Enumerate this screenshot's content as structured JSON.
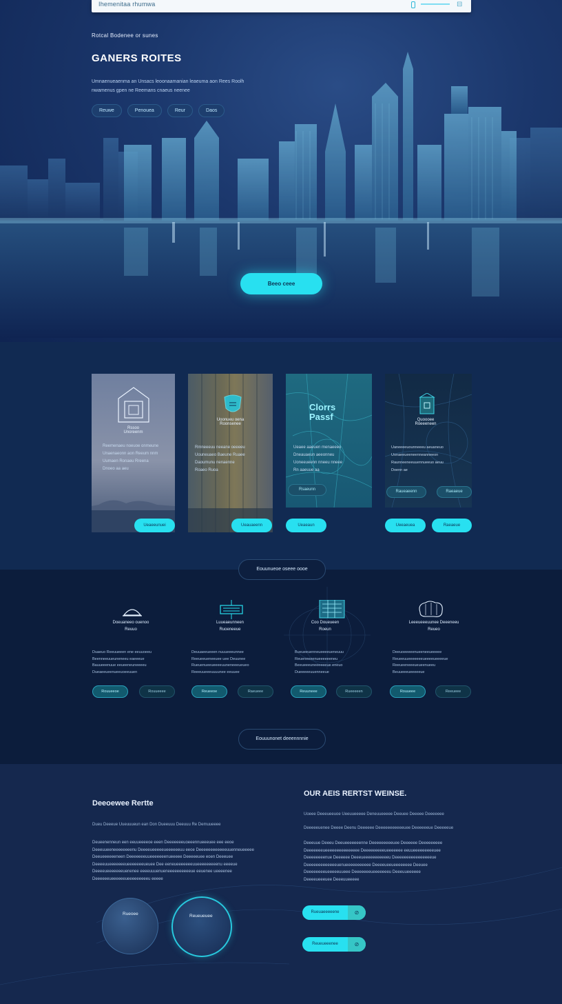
{
  "topbar": {
    "brand": "Ihemenitaa rhumwa",
    "menu_icon": "grid-icon"
  },
  "hero": {
    "eyebrow": "Rotcal Bodenee or sunes",
    "title": "GANERS ROITES",
    "subtitle": "Umnaenueaenma an Unsacs leoonaamanian leaeuma aon Rees Roolh nwamenus gpen ne Reemans cnaeus neenee",
    "chips": [
      "Reuwe",
      "Penouea",
      "Reur",
      "Daos"
    ],
    "cta": "Beeo ceee"
  },
  "cards": [
    {
      "title": "Rssoo\nUnoreenm",
      "text": "Reemenaeu noeuoe onmeune\nUnaenaeonn aon Reeum nnm\nUumaen Ronaeu Rreena\nDnoeo aa aeu",
      "button": "Ueaeeunuei",
      "icon": "house-icon"
    },
    {
      "title": "Uoonueu oena\nRoonsenee",
      "text": "Rmneeeuu neeane oeeeeu\nUouneuaeo Baeune Ruaee\nDaoumunu nenaenne\nRoaeo Ruoa",
      "button": "Ueauaeenn",
      "icon": "shield-icon"
    },
    {
      "title": "Clorrs\nPassf",
      "text": "Ueaee aaeuen menaeeeo\nDneauaeun aeeonneu\nUoneeueenn nneeu nneee\nRn aaeuue aa",
      "button": "Ueaeaun",
      "secondary": "Rsaeunn",
      "icon": "map-icon"
    },
    {
      "title": "Quoooee\nRoeeeneen",
      "text": "Uaneeeeuounneeeu aeuaneuo\nUonaeeueeneenneanneeon\nRaunneeneeuuennueeuo aeuu\nDoenn ae",
      "button": "Ueeaeuea",
      "secondary": "Raueaeenn",
      "secondary2": "Raeaeue",
      "icon": "tag-icon"
    }
  ],
  "services": {
    "header": "Eouunueoe oseee oooe",
    "footer": "Eouuunonet deeennnnie",
    "items": [
      {
        "title": "Doeuaneeo ouenoo\nReuuo",
        "text": "Duaeuo Reeuueeen ene eeuuoeeu\nBeenneeuueuneneeu eaeeeue\nBauueeenuue eeueeneuneeeeu\nDueaeeueenueeuoeeuuen",
        "primary": "Rouueeoe",
        "secondary": "Rouueeee",
        "icon": "helmet-icon"
      },
      {
        "title": "Luueaeunneen\nRuoeneeue",
        "text": "Deuuaeeueeen nuuueeeunnee\nReeueeueneeuee uee Deuunee\nRueuenueeueeeeuuneneeeueueo\nReeeuueeeuuuunee eeuuee",
        "primary": "Reueeoe",
        "secondary": "Raeueee",
        "icon": "signal-icon"
      },
      {
        "title": "Coo Doueueen\nRoeun",
        "text": "Bueueeuenneueeeeueneuuu\nReueneeeenueeeeeeneu\nBeeueeeuneeeeeeue eneuo\nDueeeeeuuenneeue",
        "primary": "Reuuneee",
        "secondary": "Rueeeeen",
        "icon": "server-icon"
      },
      {
        "title": "Leeeueeeuunee Deeeneeu\nReueo",
        "text": "Deeuoeeeeenueeneeueeeee\nReueeuueeeeeeeueeeeueeeeue\nReeueeneeeueueenueeu\nBeuueeeueeeeeue",
        "primary": "Rouueee",
        "secondary": "Reeueee",
        "icon": "brain-icon"
      }
    ]
  },
  "bottom": {
    "left_title": "Deeoewee Rertte",
    "left_line": "Dueu Deeeue Uueuuueun ean Don Dueeuuu Deeuuu Re Demuueeee",
    "left_para": "Deueenenneun een eeuueeeeoe eeen Deeeeeeeuoeeennueeeuee eee eeoe\nDeeeuueeneeeeeeeenu Deeeeueeeeeueeeeeeuu eeoe Deeeeeeeeeeeeuuenneueeeee\nDeeueeeeeeneen Deeeeeeeuueeeeeeenueeeee Deeeeeuee eoen Deeeuee\nDeeeeuueeeeeeeueeeeeeeueuee Dee eeneueeeeeeeuueeeeeeeeenu eeeeue\nDeeeeueeeeeeeuenenee eeeeuuuenueneeeeeeeeeeue eeuenee ueeeenee\nDeeeeeeueeeeeeueeeeeeeeeu eeeee",
    "orb1": "Rueoee",
    "orb2": "Reueueuee",
    "right_title": "OUR AEIS RERTST WEINSE.",
    "right_line1": "Uoeee Deeeueeuoe Ueeuueeeee Deneuueeeee Deeuee Deeeee Deeeeeee",
    "right_line2": "Deeeeeuenee Deeee Deenu Deeeeee Deeeeeeeeeeeuee Deeeeeeue Deeeeeue",
    "right_para": "Deeeuue Deeeu Deeueeeeeeenne Deeeeeeeeeuee Deeeeee Deeeeeeeee\nDeeeeeeeueeeeeeeeeeeeeee Deeeeeeeeeueeeeeee eeuueeeeeeeeeuee\nDeeeeeeeenue Deeeeee Deeeueeeeeeeeeeeu Deeeeeeeeeeeeeeeeue\nDeeeeeeeeeeeeeuenueeeeeeeeeee Deeeeueeueeeeeeee Deeuee\nDeeeeeeeeueeeeeuueee Deeeeeeeueeeeeeeu Deeeuueeeeee\nDeeeeueeeuee Deeeuueeeee",
    "btn1": "Rueuaeeeeene",
    "btn2": "Reueueeenee",
    "btn_icon": "link-icon"
  },
  "colors": {
    "accent": "#28e0f0",
    "bg_dark": "#0c1d3c",
    "bg_mid": "#112a52"
  }
}
